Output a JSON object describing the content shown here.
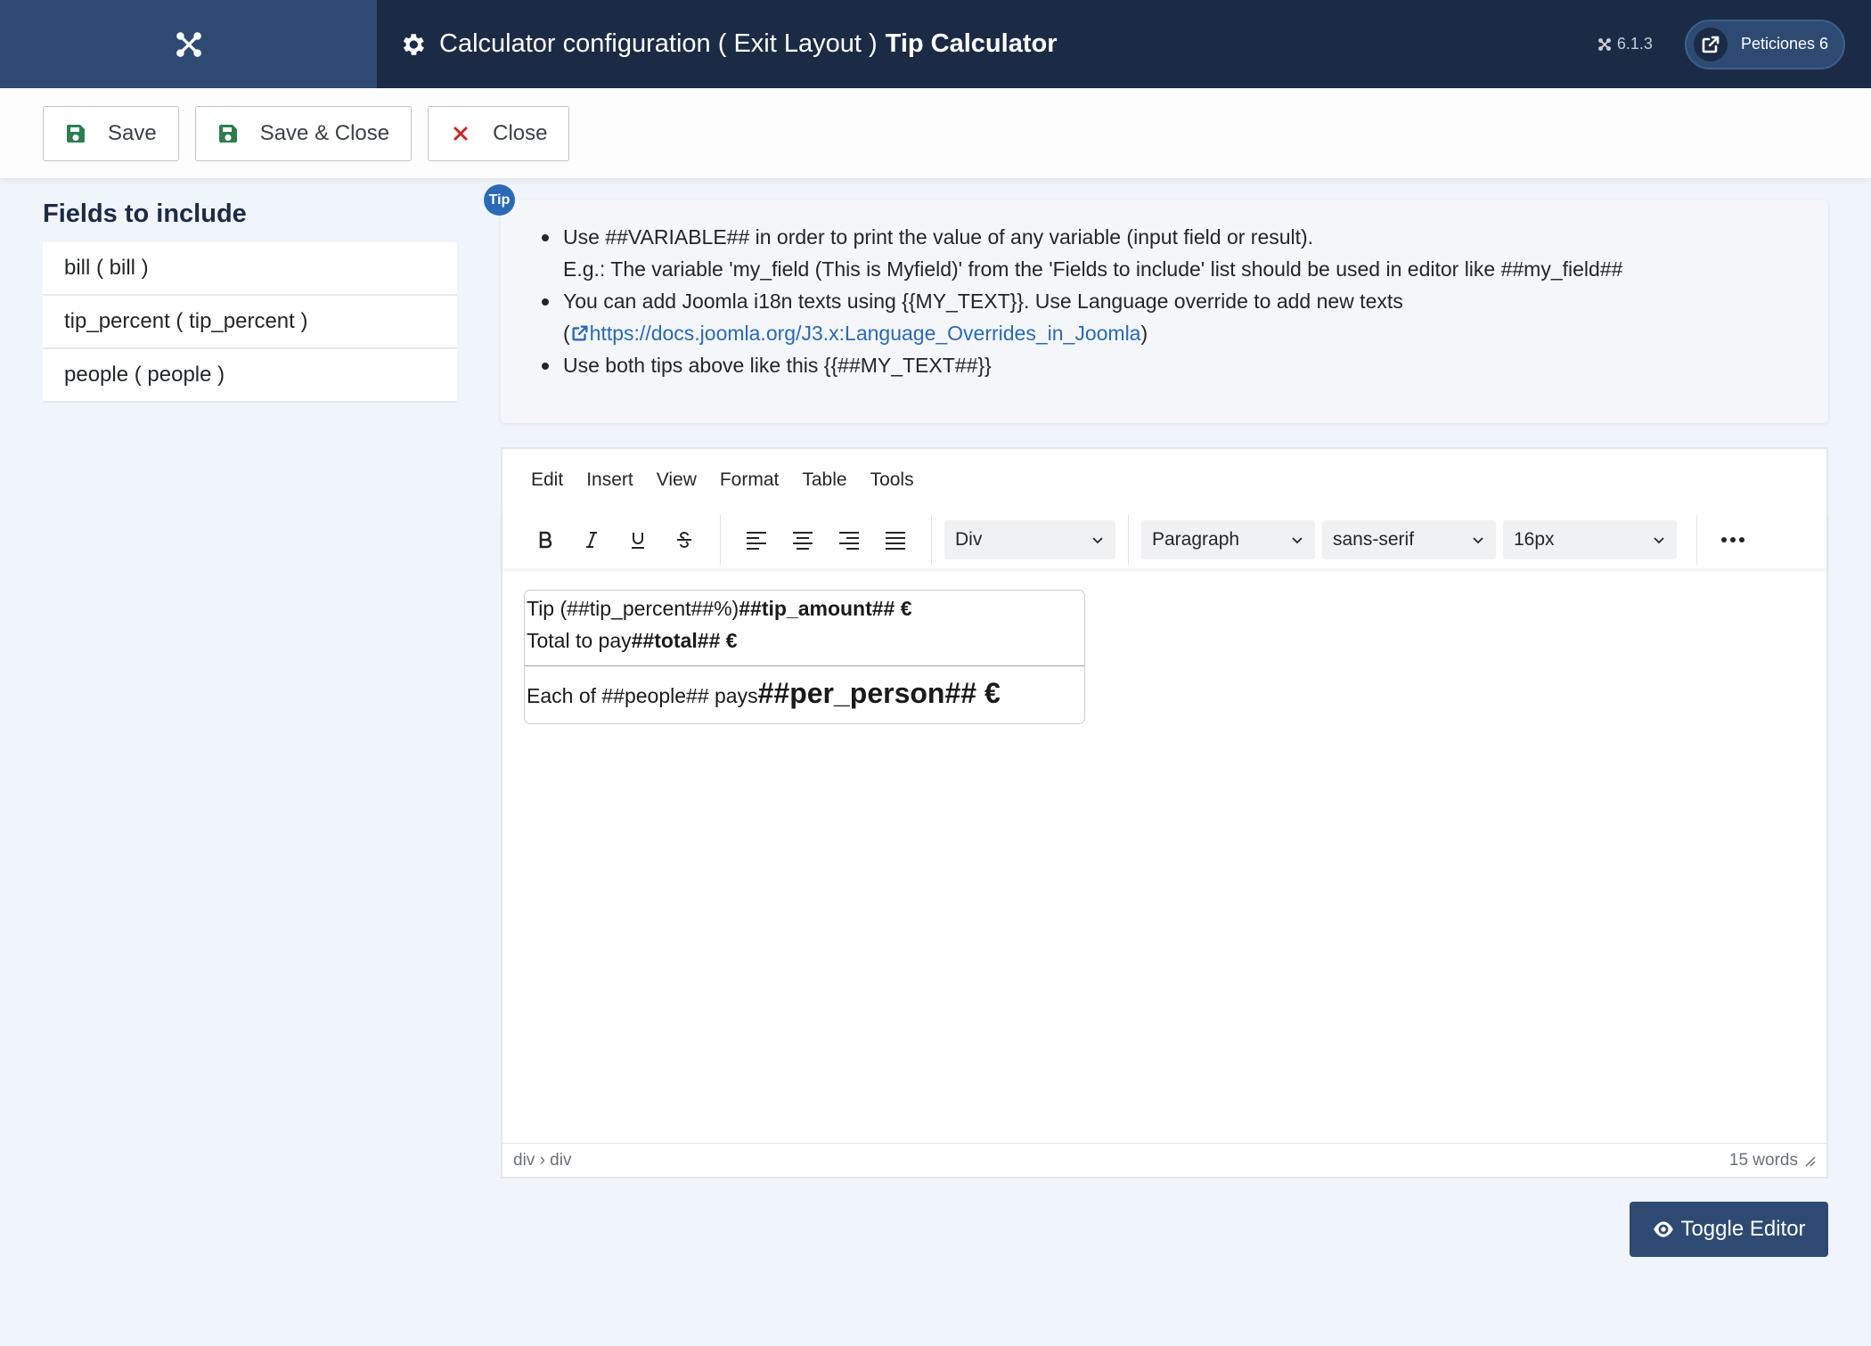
{
  "header": {
    "title_prefix": "Calculator configuration ( Exit Layout )",
    "title_strong": "Tip Calculator",
    "version": "6.1.3",
    "requests_label": "Peticiones 6",
    "colors": {
      "header_bg": "#1c2b45",
      "logo_bg": "#2e4a73"
    }
  },
  "toolbar": {
    "save_label": "Save",
    "save_close_label": "Save & Close",
    "close_label": "Close",
    "colors": {
      "save_icon": "#2f7d4f",
      "close_icon": "#c52827"
    }
  },
  "fields": {
    "title": "Fields to include",
    "items": [
      {
        "label": "bill ( bill )"
      },
      {
        "label": "tip_percent ( tip_percent )"
      },
      {
        "label": "people ( people )"
      }
    ]
  },
  "tips": {
    "badge": "Tip",
    "line1": "Use ##VARIABLE## in order to print the value of any variable (input field or result).",
    "line1b": "E.g.: The variable 'my_field (This is Myfield)' from the 'Fields to include' list should be used in editor like ##my_field##",
    "line2": "You can add Joomla i18n texts using {{MY_TEXT}}. Use Language override to add new texts",
    "line2_open": "(",
    "link": "https://docs.joomla.org/J3.x:Language_Overrides_in_Joomla",
    "line2_close": ")",
    "line3": "Use both tips above like this {{##MY_TEXT##}}"
  },
  "editor": {
    "menu": [
      "Edit",
      "Insert",
      "View",
      "Format",
      "Table",
      "Tools"
    ],
    "block_select": "Div",
    "format_select": "Paragraph",
    "font_select": "sans-serif",
    "size_select": "16px",
    "content": {
      "tip_text": "Tip (##tip_percent##%)",
      "tip_value": "##tip_amount## €",
      "total_text": "Total to pay",
      "total_value": "##total## €",
      "each_text": "Each of ##people## pays",
      "each_value": "##per_person## €"
    },
    "path": "div › div",
    "word_count": "15 words"
  },
  "toggle_editor_label": "Toggle Editor"
}
